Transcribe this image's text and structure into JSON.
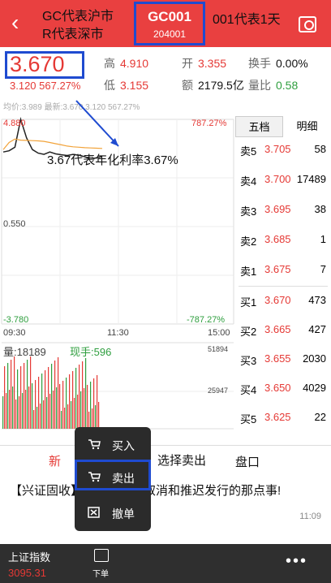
{
  "header": {
    "back_icon": "chevron-left-icon",
    "legend_line1": "GC代表沪市",
    "legend_line2": "R代表深市",
    "code": "GC001",
    "code_sub": "204001",
    "code_note": "001代表1天",
    "scan_icon": "scan-search-icon"
  },
  "quote": {
    "price": "3.670",
    "change": "3.120",
    "change_pct": "567.27%",
    "high_label": "高",
    "high": "4.910",
    "open_label": "开",
    "open": "3.355",
    "turnover_label": "换手",
    "turnover": "0.00%",
    "low_label": "低",
    "low": "3.155",
    "amount_label": "额",
    "amount": "2179.5亿",
    "vol_ratio_label": "量比",
    "vol_ratio": "0.58"
  },
  "chart": {
    "subtitle": "均价:3.989 最新:3.670 3.120 567.27%",
    "annotation": "3.67代表年化利率3.67%",
    "y_top_left": "4.880",
    "y_top_right": "787.27%",
    "y_mid": "0.550",
    "y_bottom_left": "-3.780",
    "y_bottom_right": "-787.27%",
    "time_start": "09:30",
    "time_mid": "11:30",
    "time_end": "15:00",
    "vol_label": "量:18189",
    "hand_label": "现手:596",
    "vol_axis_top": "51894",
    "vol_axis_mid": "25947",
    "colors": {
      "price_line": "#222222",
      "avg_line": "#f2a33a",
      "vol_up": "#e53935",
      "vol_down": "#2e9e3e"
    }
  },
  "chart_data": {
    "type": "line",
    "title": "",
    "ylim": [
      -3.78,
      4.88
    ],
    "series": [
      {
        "name": "最新",
        "values": [
          3.5,
          3.55,
          3.7,
          4.88,
          4.1,
          3.6,
          3.45,
          3.4,
          3.5,
          3.42,
          3.38,
          3.35,
          3.4,
          3.36,
          3.3,
          3.2,
          3.25,
          3.3
        ]
      },
      {
        "name": "均价",
        "values": [
          3.6,
          3.9,
          4.05,
          4.0,
          3.99,
          3.98,
          3.97,
          3.95,
          3.9,
          3.85,
          3.8,
          3.75,
          3.72,
          3.7,
          3.68,
          3.67,
          3.66,
          3.65
        ]
      }
    ]
  },
  "orderbook": {
    "tab_active": "五档",
    "tab_other": "明细",
    "asks": [
      {
        "label": "卖5",
        "price": "3.705",
        "vol": "58"
      },
      {
        "label": "卖4",
        "price": "3.700",
        "vol": "17489"
      },
      {
        "label": "卖3",
        "price": "3.695",
        "vol": "38"
      },
      {
        "label": "卖2",
        "price": "3.685",
        "vol": "1"
      },
      {
        "label": "卖1",
        "price": "3.675",
        "vol": "7"
      }
    ],
    "bids": [
      {
        "label": "买1",
        "price": "3.670",
        "vol": "473"
      },
      {
        "label": "买2",
        "price": "3.665",
        "vol": "427"
      },
      {
        "label": "买3",
        "price": "3.655",
        "vol": "2030"
      },
      {
        "label": "买4",
        "price": "3.650",
        "vol": "4029"
      },
      {
        "label": "买5",
        "price": "3.625",
        "vol": "22"
      }
    ]
  },
  "tabbar": {
    "tab_news": "新",
    "tab_disk": "盘口"
  },
  "news": {
    "title": "【兴证固收】研究：关于取消和推迟发行的那点事!",
    "time": "11:09"
  },
  "popup": {
    "buy": "买入",
    "sell": "卖出",
    "cancel": "撤单",
    "note": "选择卖出"
  },
  "bottom": {
    "index_name": "上证指数",
    "index_value": "3095.31",
    "order_label": "下单",
    "more_icon": "more-dots-icon"
  }
}
